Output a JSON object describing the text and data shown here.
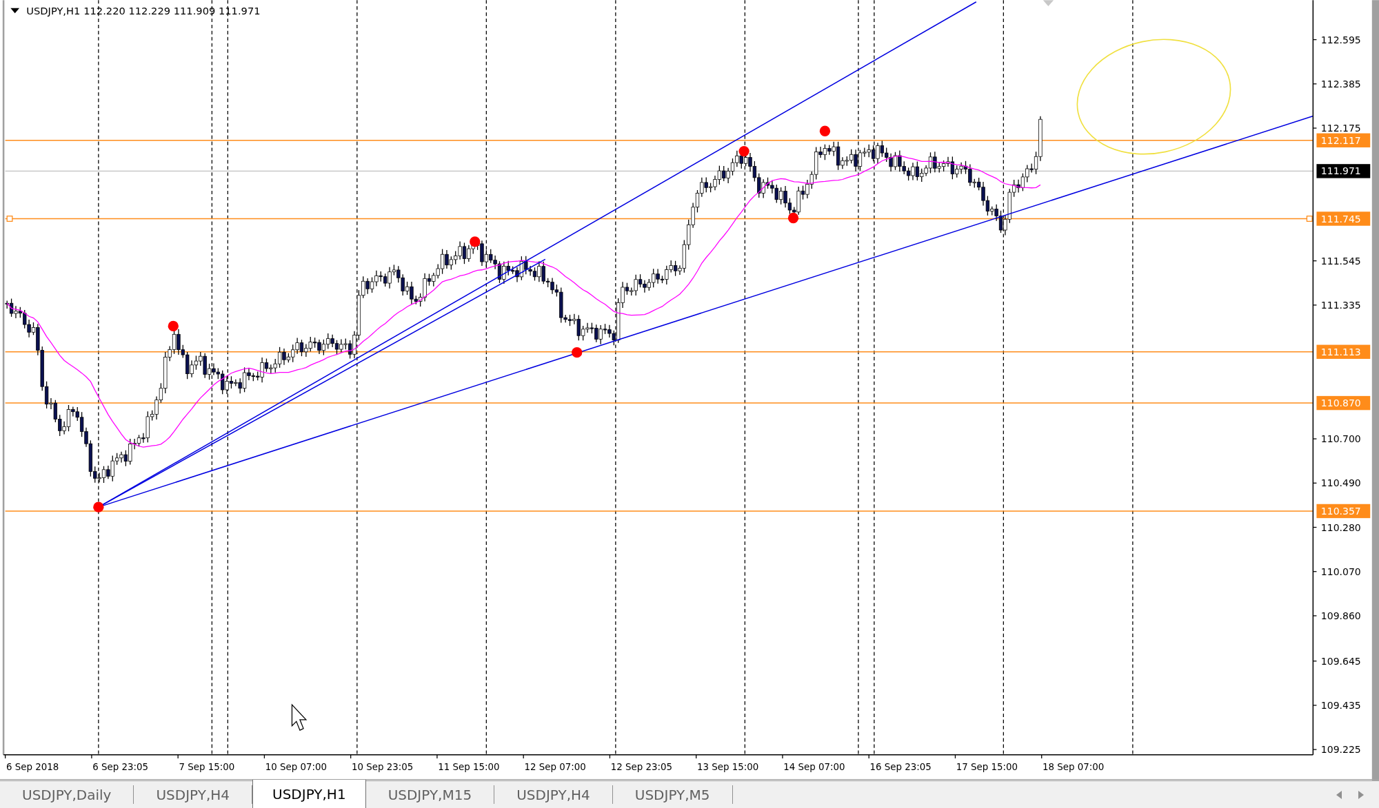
{
  "chart": {
    "symbol": "USDJPY,H1",
    "ohlc": "112.220 112.229 111.909 111.971",
    "price_ticks": [
      "112.595",
      "112.385",
      "112.175",
      "111.545",
      "111.335",
      "110.700",
      "110.490",
      "110.280",
      "110.070",
      "109.860",
      "109.645",
      "109.435",
      "109.225"
    ],
    "level_tags": [
      {
        "label": "112.117",
        "kind": "level"
      },
      {
        "label": "111.971",
        "kind": "bid"
      },
      {
        "label": "111.745",
        "kind": "level"
      },
      {
        "label": "111.113",
        "kind": "level"
      },
      {
        "label": "110.870",
        "kind": "level"
      },
      {
        "label": "110.357",
        "kind": "level"
      }
    ],
    "time_labels": [
      "6 Sep 2018",
      "6 Sep 23:05",
      "7 Sep 15:00",
      "10 Sep 07:00",
      "10 Sep 23:05",
      "11 Sep 15:00",
      "12 Sep 07:00",
      "12 Sep 23:05",
      "13 Sep 15:00",
      "14 Sep 07:00",
      "16 Sep 23:05",
      "17 Sep 15:00",
      "18 Sep 07:00"
    ]
  },
  "tabs": [
    {
      "label": "USDJPY,Daily",
      "selected": false
    },
    {
      "label": "USDJPY,H4",
      "selected": false
    },
    {
      "label": "USDJPY,H1",
      "selected": true
    },
    {
      "label": "USDJPY,M15",
      "selected": false
    },
    {
      "label": "USDJPY,H4",
      "selected": false
    },
    {
      "label": "USDJPY,M5",
      "selected": false
    }
  ]
}
